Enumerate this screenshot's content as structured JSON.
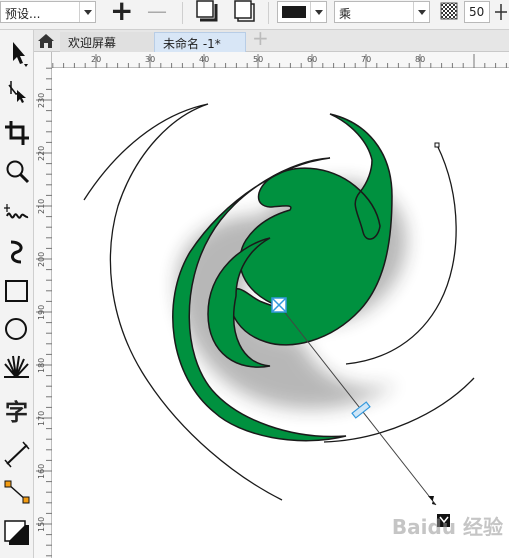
{
  "propbar": {
    "preset_value": "预设...",
    "add_preset": "+",
    "remove_preset": "—",
    "shadow_color": "#1a1a1a",
    "merge_mode": "乘",
    "opacity": "50"
  },
  "tabs": [
    {
      "label": "欢迎屏幕",
      "active": false
    },
    {
      "label": "未命名 -1*",
      "active": true
    }
  ],
  "new_tab": "+",
  "toolbox": [
    "pick-tool",
    "shape-tool",
    "crop-tool",
    "zoom-tool",
    "freehand-tool",
    "artistic-media-tool",
    "rectangle-tool",
    "ellipse-tool",
    "polygon-tool",
    "text-tool",
    "parallel-dimension-tool",
    "connector-tool",
    "drop-shadow-tool"
  ],
  "text_tool_glyph": "字",
  "hruler": {
    "labels": [
      "20",
      "30",
      "40",
      "50",
      "60",
      "70",
      "80"
    ]
  },
  "vruler": {
    "labels": [
      "230",
      "220",
      "210",
      "200",
      "190",
      "180",
      "170",
      "160",
      "150"
    ]
  },
  "canvas": {
    "shape_fill": "#00913f",
    "shape_outline": "#1a1a1a",
    "handle_color": "#3399dd"
  },
  "watermark": "Baidu 经验"
}
